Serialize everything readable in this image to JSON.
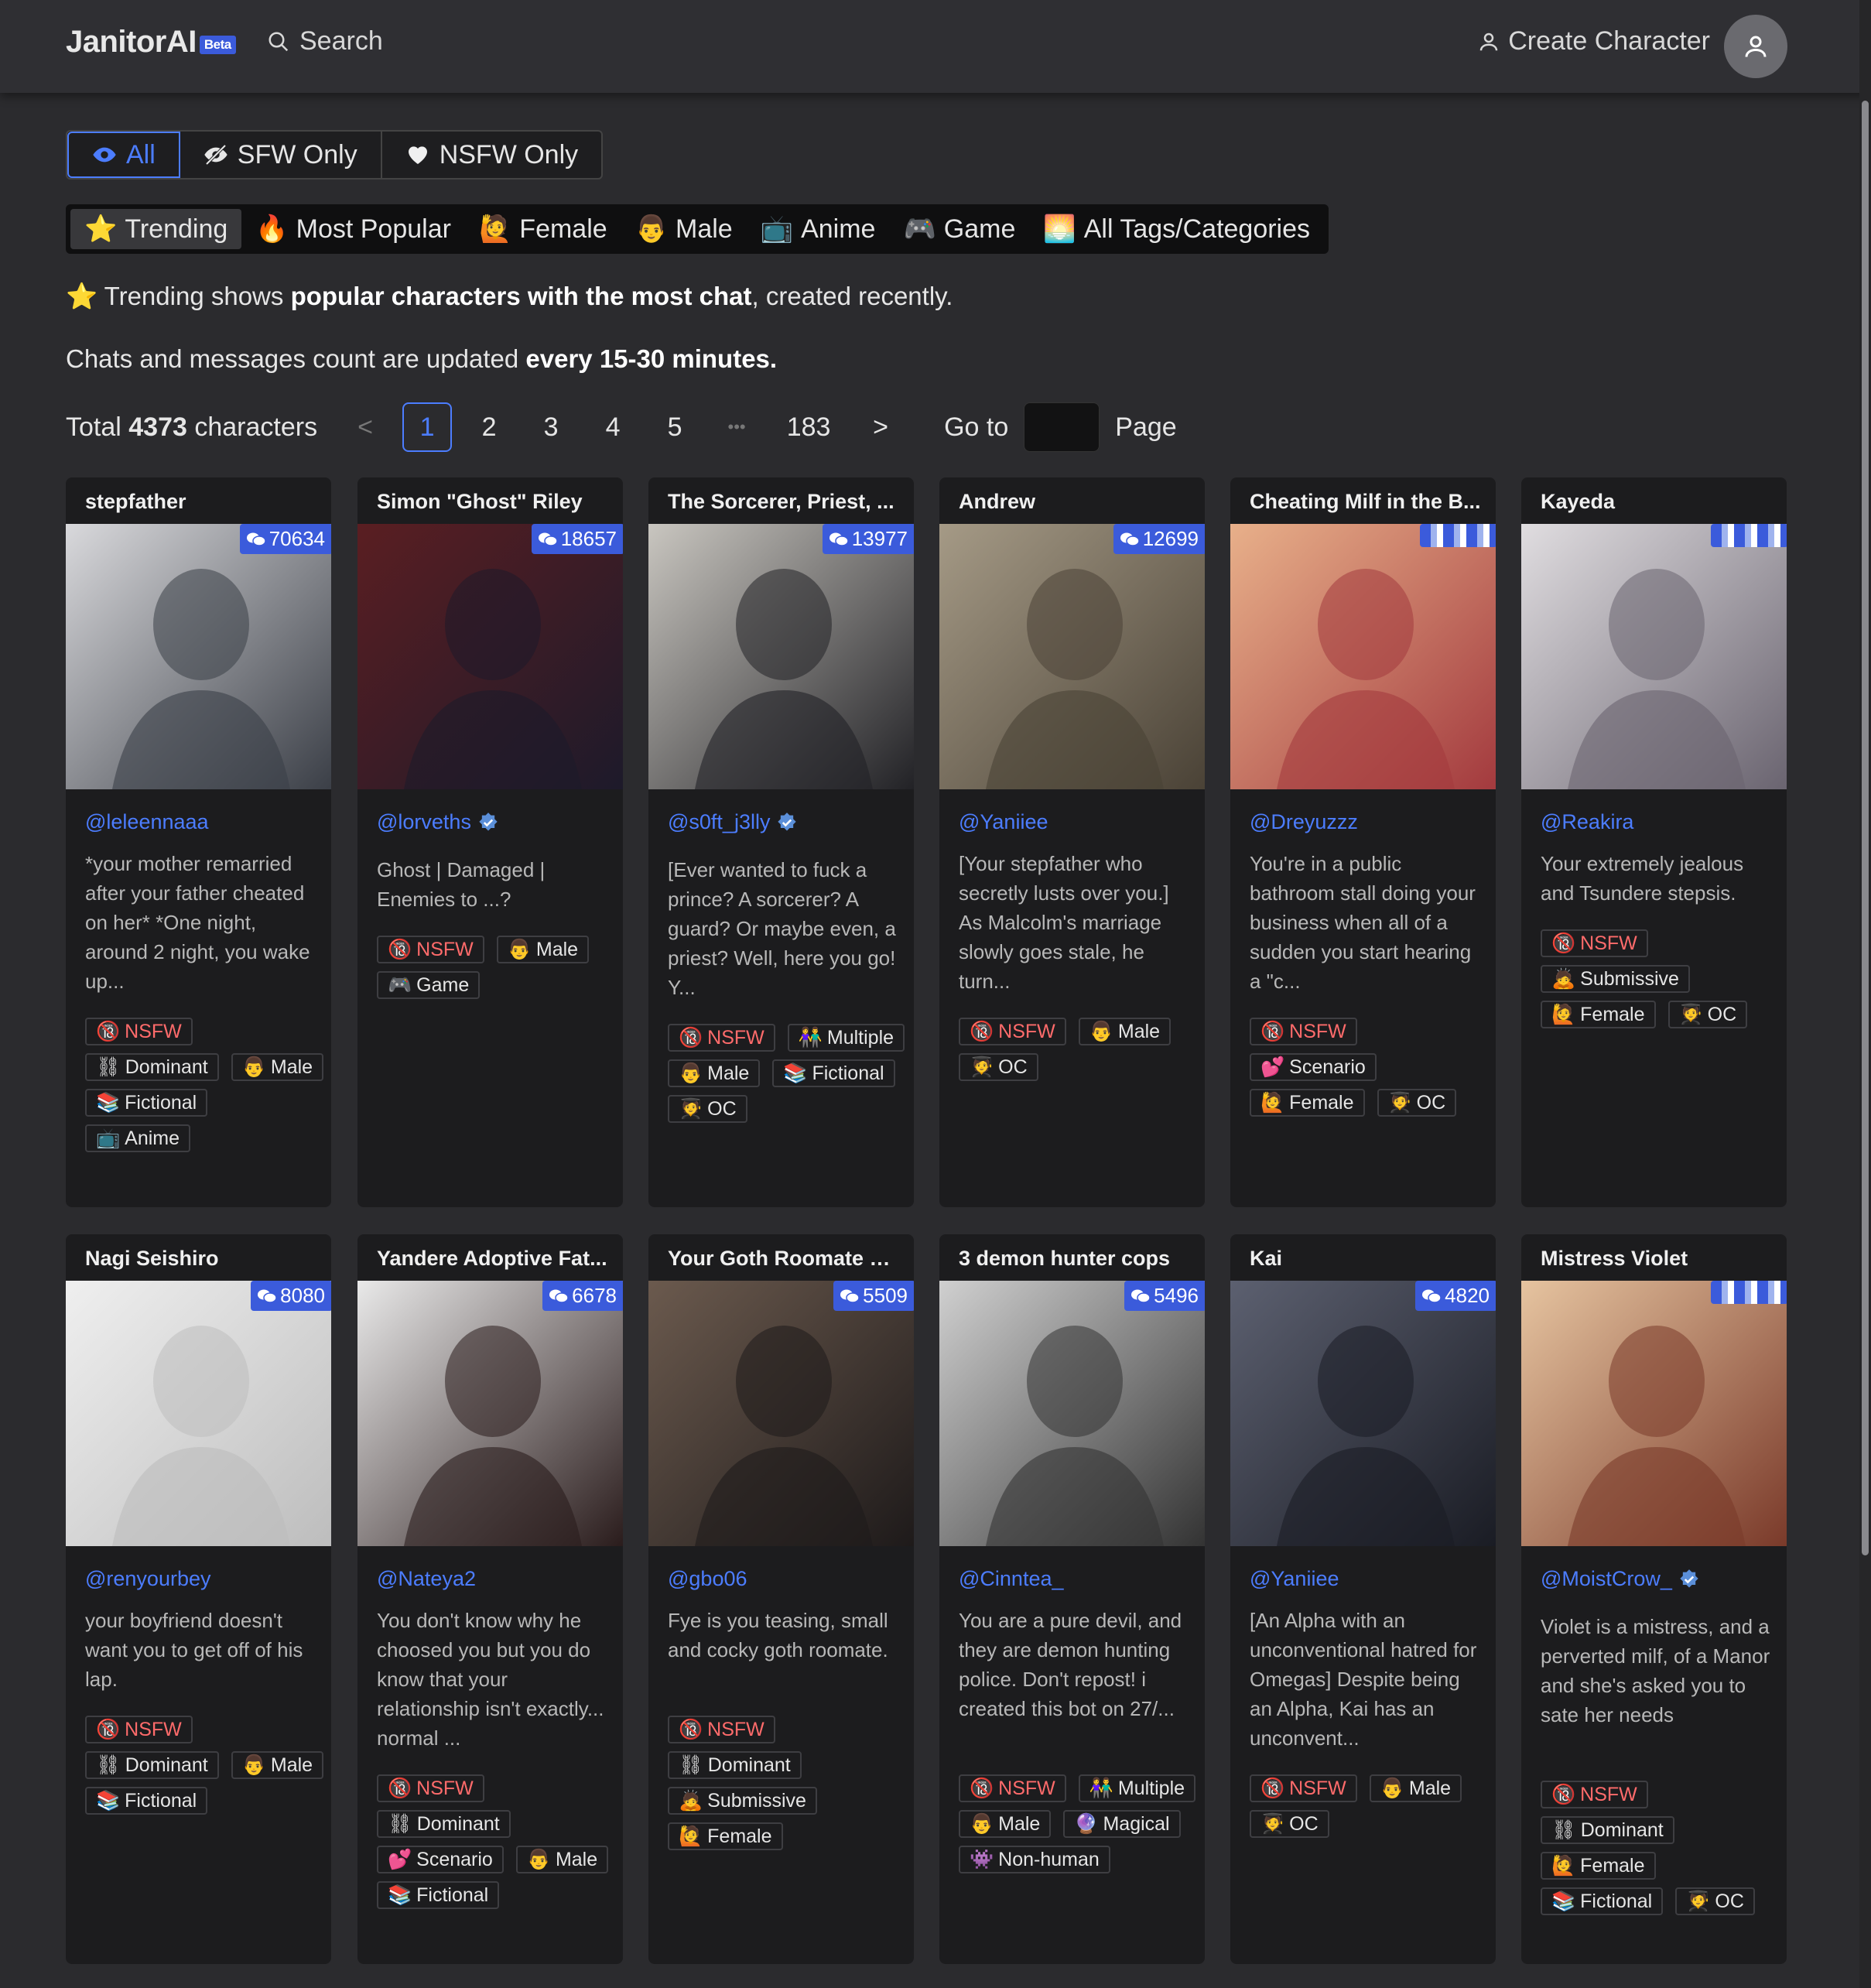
{
  "header": {
    "logo": "JanitorAI",
    "beta": "Beta",
    "search_label": "Search",
    "create_label": "Create Character"
  },
  "filters": [
    {
      "label": "All",
      "icon": "eye-icon",
      "active": true
    },
    {
      "label": "SFW Only",
      "icon": "eye-slash-icon",
      "active": false
    },
    {
      "label": "NSFW Only",
      "icon": "heart-icon",
      "active": false
    }
  ],
  "categories": [
    {
      "label": "Trending",
      "emoji": "⭐",
      "active": true
    },
    {
      "label": "Most Popular",
      "emoji": "🔥",
      "active": false
    },
    {
      "label": "Female",
      "emoji": "🙋",
      "active": false
    },
    {
      "label": "Male",
      "emoji": "👨",
      "active": false
    },
    {
      "label": "Anime",
      "emoji": "📺",
      "active": false
    },
    {
      "label": "Game",
      "emoji": "🎮",
      "active": false
    },
    {
      "label": "All Tags/Categories",
      "emoji": "🌅",
      "active": false
    }
  ],
  "info": {
    "line1_prefix": "⭐ Trending shows ",
    "line1_bold": "popular characters with the most chat",
    "line1_suffix": ", created recently.",
    "line2_prefix": "Chats and messages count are updated ",
    "line2_bold": "every 15-30 minutes."
  },
  "pagination": {
    "total_prefix": "Total ",
    "total_count": "4373",
    "total_suffix": " characters",
    "prev": "<",
    "pages": [
      "1",
      "2",
      "3",
      "4",
      "5"
    ],
    "ellipsis": "•••",
    "last_page": "183",
    "next": ">",
    "current": "1",
    "goto_label": "Go to",
    "page_label": "Page"
  },
  "cards": [
    {
      "name": "stepfather",
      "chats": "70634",
      "creator": "@leleennaaa",
      "verified": false,
      "desc": "*your mother remarried after your father cheated on her* *One night, around 2 night, you wake up...",
      "tags": [
        [
          "🔞",
          "NSFW"
        ],
        [
          "⛓",
          "Dominant"
        ],
        [
          "👨",
          "Male"
        ],
        [
          "📚",
          "Fictional"
        ],
        [
          "📺",
          "Anime"
        ]
      ],
      "img": [
        "#d9d9dc",
        "#3b3f47"
      ]
    },
    {
      "name": "Simon \"Ghost\" Riley",
      "chats": "18657",
      "creator": "@lorveths",
      "verified": true,
      "desc": "Ghost | Damaged | Enemies to ...?",
      "tags": [
        [
          "🔞",
          "NSFW"
        ],
        [
          "👨",
          "Male"
        ],
        [
          "🎮",
          "Game"
        ]
      ],
      "img": [
        "#5a1e22",
        "#1d1a2a"
      ]
    },
    {
      "name": "The Sorcerer, Priest, ...",
      "chats": "13977",
      "creator": "@s0ft_j3lly",
      "verified": true,
      "desc": "[Ever wanted to fuck a prince? A sorcerer? A guard? Or maybe even, a priest? Well, here you go! Y...",
      "tags": [
        [
          "🔞",
          "NSFW"
        ],
        [
          "👫",
          "Multiple"
        ],
        [
          "👨",
          "Male"
        ],
        [
          "📚",
          "Fictional"
        ],
        [
          "🧑‍🎓",
          "OC"
        ]
      ],
      "img": [
        "#c9c6c0",
        "#222226"
      ]
    },
    {
      "name": "Andrew",
      "chats": "12699",
      "creator": "@Yaniiee",
      "verified": false,
      "desc": "[Your stepfather who secretly lusts over you.] As Malcolm's marriage slowly goes stale, he turn...",
      "tags": [
        [
          "🔞",
          "NSFW"
        ],
        [
          "👨",
          "Male"
        ],
        [
          "🧑‍🎓",
          "OC"
        ]
      ],
      "img": [
        "#a59a86",
        "#4a4236"
      ]
    },
    {
      "name": "Cheating Milf in the B...",
      "chats": "",
      "creator": "@Dreyuzzz",
      "verified": false,
      "desc": "You're in a public bathroom stall doing your business when all of a sudden you start hearing a \"c...",
      "tags": [
        [
          "🔞",
          "NSFW"
        ],
        [
          "💕",
          "Scenario"
        ],
        [
          "🙋",
          "Female"
        ],
        [
          "🧑‍🎓",
          "OC"
        ]
      ],
      "img": [
        "#e8b08a",
        "#a33a3e"
      ]
    },
    {
      "name": "Kayeda",
      "chats": "",
      "creator": "@Reakira",
      "verified": false,
      "desc": "Your extremely jealous and Tsundere stepsis.",
      "tags": [
        [
          "🔞",
          "NSFW"
        ],
        [
          "🙇",
          "Submissive"
        ],
        [
          "🙋",
          "Female"
        ],
        [
          "🧑‍🎓",
          "OC"
        ]
      ],
      "img": [
        "#e0dde0",
        "#6a6470"
      ]
    },
    {
      "name": "Nagi Seishiro",
      "chats": "8080",
      "creator": "@renyourbey",
      "verified": false,
      "desc": "your boyfriend doesn't want you to get off of his lap.",
      "tags": [
        [
          "🔞",
          "NSFW"
        ],
        [
          "⛓",
          "Dominant"
        ],
        [
          "👨",
          "Male"
        ],
        [
          "📚",
          "Fictional"
        ]
      ],
      "img": [
        "#efefef",
        "#bdbdbd"
      ]
    },
    {
      "name": "Yandere Adoptive Fat...",
      "chats": "6678",
      "creator": "@Nateya2",
      "verified": false,
      "desc": "You don't know why he choosed you but you do know that your relationship isn't exactly... normal ...",
      "tags": [
        [
          "🔞",
          "NSFW"
        ],
        [
          "⛓",
          "Dominant"
        ],
        [
          "💕",
          "Scenario"
        ],
        [
          "👨",
          "Male"
        ],
        [
          "📚",
          "Fictional"
        ]
      ],
      "img": [
        "#e9e9e9",
        "#2a1c1c"
      ]
    },
    {
      "name": "Your Goth Roomate Fye",
      "chats": "5509",
      "creator": "@gbo06",
      "verified": false,
      "desc": "Fye is you teasing, small and cocky goth roomate.",
      "tags": [
        [
          "🔞",
          "NSFW"
        ],
        [
          "⛓",
          "Dominant"
        ],
        [
          "🙇",
          "Submissive"
        ],
        [
          "🙋",
          "Female"
        ]
      ],
      "img": [
        "#6b5a4e",
        "#1e1a1a"
      ]
    },
    {
      "name": "3 demon hunter cops",
      "chats": "5496",
      "creator": "@Cinntea_",
      "verified": false,
      "desc": "You are a pure devil, and they are demon hunting police. Don't repost! i created this bot on 27/...",
      "tags": [
        [
          "🔞",
          "NSFW"
        ],
        [
          "👫",
          "Multiple"
        ],
        [
          "👨",
          "Male"
        ],
        [
          "🔮",
          "Magical"
        ],
        [
          "👾",
          "Non-human"
        ]
      ],
      "img": [
        "#d0d0d0",
        "#333333"
      ]
    },
    {
      "name": "Kai",
      "chats": "4820",
      "creator": "@Yaniiee",
      "verified": false,
      "desc": "[An Alpha with an unconventional hatred for Omegas] Despite being an Alpha, Kai has an unconvent...",
      "tags": [
        [
          "🔞",
          "NSFW"
        ],
        [
          "👨",
          "Male"
        ],
        [
          "🧑‍🎓",
          "OC"
        ]
      ],
      "img": [
        "#5c6070",
        "#1a1c24"
      ]
    },
    {
      "name": "Mistress Violet",
      "chats": "",
      "creator": "@MoistCrow_",
      "verified": true,
      "desc": "Violet is a mistress, and a perverted milf, of a Manor and she's asked you to sate her needs",
      "tags": [
        [
          "🔞",
          "NSFW"
        ],
        [
          "⛓",
          "Dominant"
        ],
        [
          "🙋",
          "Female"
        ],
        [
          "📚",
          "Fictional"
        ],
        [
          "🧑‍🎓",
          "OC"
        ]
      ],
      "img": [
        "#e6c4a0",
        "#7a3a2a"
      ]
    }
  ]
}
